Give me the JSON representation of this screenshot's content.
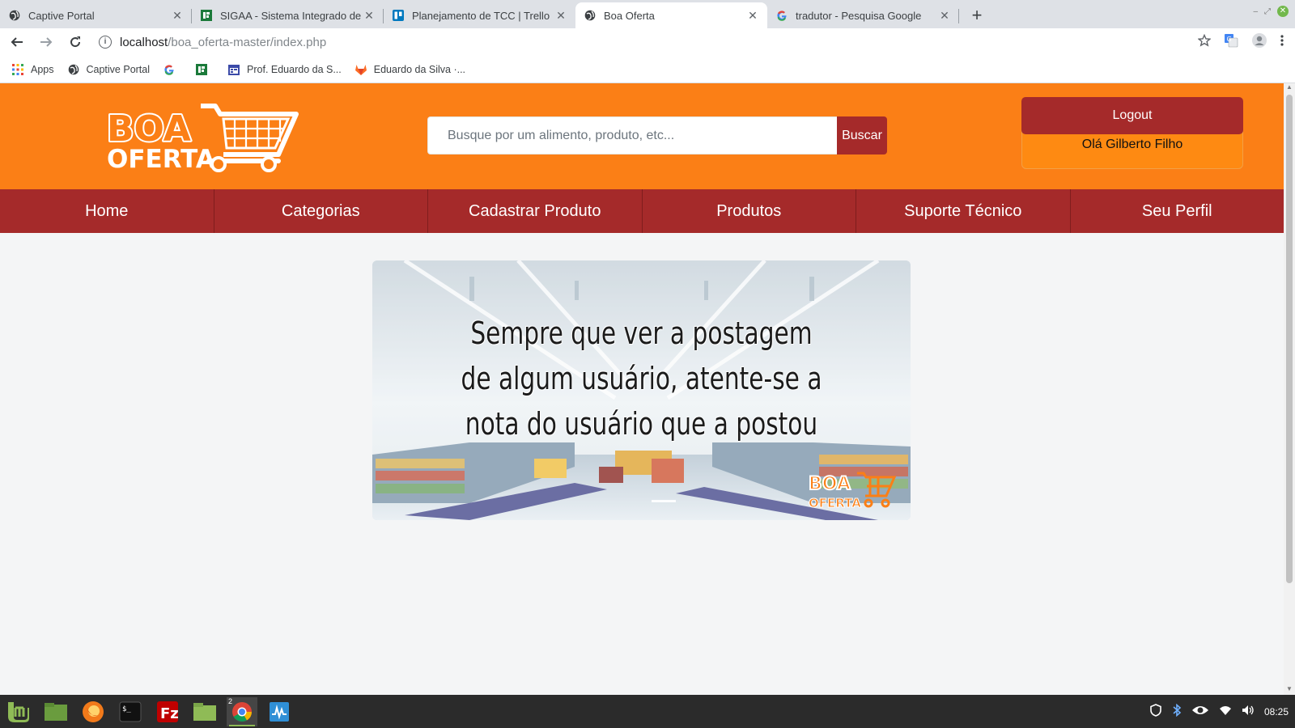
{
  "browser": {
    "tabs": [
      {
        "label": "Captive Portal",
        "icon": "globe-icon",
        "active": false
      },
      {
        "label": "SIGAA - Sistema Integrado de Gestão",
        "icon": "sigaa-icon",
        "active": false
      },
      {
        "label": "Planejamento de TCC | Trello",
        "icon": "trello-icon",
        "active": false
      },
      {
        "label": "Boa Oferta",
        "icon": "globe-icon",
        "active": true
      },
      {
        "label": "tradutor - Pesquisa Google",
        "icon": "google-icon",
        "active": false
      }
    ],
    "url_host": "localhost",
    "url_path": "/boa_oferta-master/index.php",
    "bookmarks": [
      {
        "label": "Apps",
        "icon": "apps-grid-icon"
      },
      {
        "label": "Captive Portal",
        "icon": "globe-icon"
      },
      {
        "label": "",
        "icon": "google-icon"
      },
      {
        "label": "",
        "icon": "sigaa-icon"
      },
      {
        "label": "Prof. Eduardo da S...",
        "icon": "calendar-icon"
      },
      {
        "label": "Eduardo da Silva ·...",
        "icon": "gitlab-icon"
      }
    ]
  },
  "site": {
    "logo_text_line1": "BOA",
    "logo_text_line2": "OFERTA",
    "search_placeholder": "Busque por um alimento, produto, etc...",
    "search_button": "Buscar",
    "logout_label": "Logout",
    "greeting": "Olá Gilberto Filho",
    "nav": [
      "Home",
      "Categorias",
      "Cadastrar Produto",
      "Produtos",
      "Suporte Técnico",
      "Seu Perfil"
    ],
    "banner_text": "Sempre que ver a postagem de algum usuário, atente-se a nota do usuário que a postou",
    "colors": {
      "orange": "#fb7f16",
      "dark_red": "#a52a2a"
    }
  },
  "taskbar": {
    "apps": [
      "mint-menu-icon",
      "files-icon",
      "firefox-icon",
      "terminal-icon",
      "filezilla-icon",
      "folder-icon",
      "chrome-icon",
      "system-monitor-icon"
    ],
    "chrome_badge": "2",
    "clock": "08:25"
  }
}
